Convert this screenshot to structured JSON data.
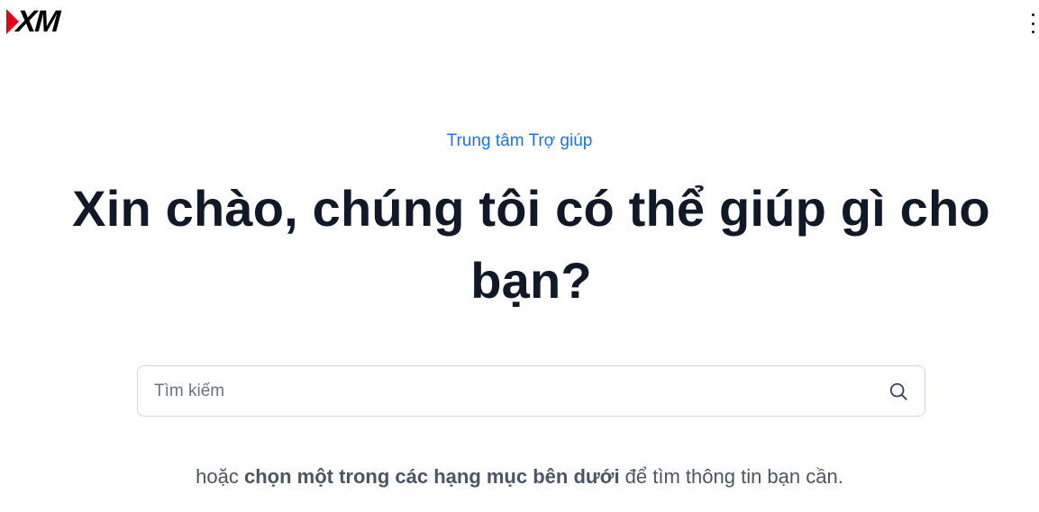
{
  "header": {
    "logo_text": "XM",
    "logo_colors": {
      "primary": "#000000",
      "accent": "#e2001a"
    },
    "menu_icon": "kebab-menu-icon"
  },
  "hero": {
    "eyebrow": "Trung tâm Trợ giúp",
    "headline": "Xin chào, chúng tôi có thể giúp gì cho bạn?"
  },
  "search": {
    "placeholder": "Tìm kiếm",
    "value": "",
    "icon": "search-icon"
  },
  "helper": {
    "prefix": "hoặc ",
    "link": "chọn một trong các hạng mục bên dưới",
    "suffix": " để tìm thông tin bạn cần."
  },
  "colors": {
    "accent": "#1a73e8",
    "headline": "#111827",
    "muted": "#4b5563",
    "border": "#d1d5db"
  }
}
